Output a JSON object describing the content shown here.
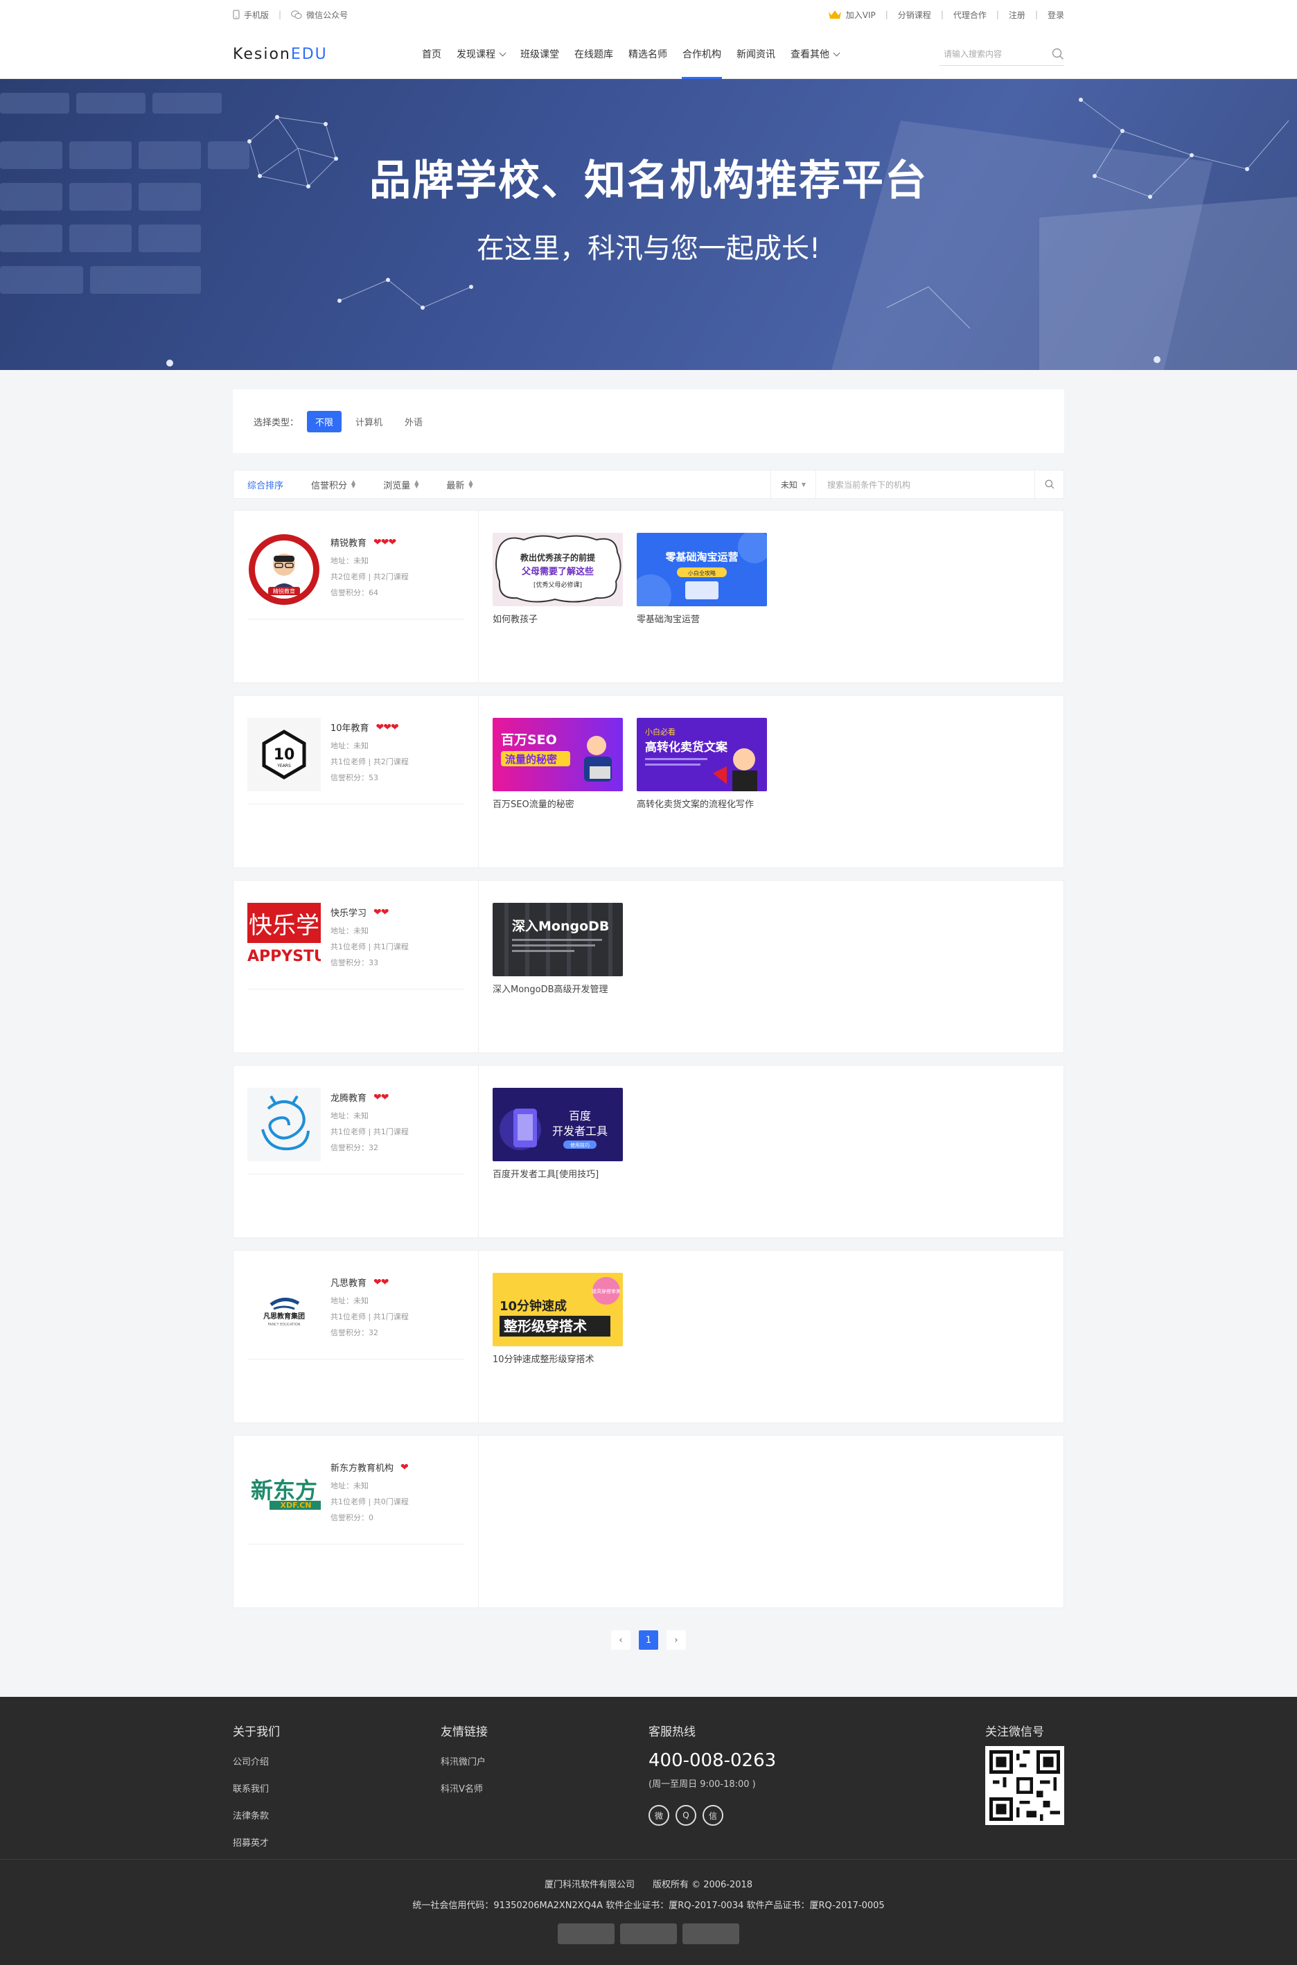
{
  "topbar": {
    "mobile": "手机版",
    "wechat_mp": "微信公众号",
    "vip": "加入VIP",
    "distribute": "分销课程",
    "agent": "代理合作",
    "register": "注册",
    "login": "登录"
  },
  "header": {
    "logo_a": "Kesion",
    "logo_b": "EDU",
    "search_placeholder": "请输入搜索内容",
    "nav": [
      {
        "label": "首页"
      },
      {
        "label": "发现课程"
      },
      {
        "label": "班级课堂"
      },
      {
        "label": "在线题库"
      },
      {
        "label": "精选名师"
      },
      {
        "label": "合作机构"
      },
      {
        "label": "新闻资讯"
      },
      {
        "label": "查看其他"
      }
    ]
  },
  "banner": {
    "title": "品牌学校、知名机构推荐平台",
    "subtitle": "在这里，科汛与您一起成长!"
  },
  "filter": {
    "label": "选择类型：",
    "tags": [
      "不限",
      "计算机",
      "外语"
    ]
  },
  "sort": {
    "items": [
      "综合排序",
      "信誉积分",
      "浏览量",
      "最新"
    ],
    "select": "未知",
    "search_placeholder": "搜索当前条件下的机构"
  },
  "orgs": [
    {
      "name": "精锐教育",
      "hearts": "❤❤❤",
      "addr": "地址：未知",
      "stats": "共2位老师 | 共2门课程",
      "credit": "信誉积分：64",
      "courses": [
        {
          "title": "如何教孩子"
        },
        {
          "title": "零基础淘宝运营"
        }
      ]
    },
    {
      "name": "10年教育",
      "hearts": "❤❤❤",
      "addr": "地址：未知",
      "stats": "共1位老师 | 共2门课程",
      "credit": "信誉积分：53",
      "courses": [
        {
          "title": "百万SEO流量的秘密"
        },
        {
          "title": "高转化卖货文案的流程化写作"
        }
      ]
    },
    {
      "name": "快乐学习",
      "hearts": "❤❤",
      "addr": "地址：未知",
      "stats": "共1位老师 | 共1门课程",
      "credit": "信誉积分：33",
      "courses": [
        {
          "title": "深入MongoDB高级开发管理"
        }
      ]
    },
    {
      "name": "龙腾教育",
      "hearts": "❤❤",
      "addr": "地址：未知",
      "stats": "共1位老师 | 共1门课程",
      "credit": "信誉积分：32",
      "courses": [
        {
          "title": "百度开发者工具[使用技巧]"
        }
      ]
    },
    {
      "name": "凡思教育",
      "hearts": "❤❤",
      "addr": "地址：未知",
      "stats": "共1位老师 | 共1门课程",
      "credit": "信誉积分：32",
      "courses": [
        {
          "title": "10分钟速成整形级穿搭术"
        }
      ]
    },
    {
      "name": "新东方教育机构",
      "hearts": "❤",
      "addr": "地址：未知",
      "stats": "共1位老师 | 共0门课程",
      "credit": "信誉积分：0",
      "courses": []
    }
  ],
  "thumbs": {
    "c1a": {
      "l1": "教出优秀孩子的前提",
      "l2": "父母需要了解这些",
      "l3": "[优秀父母必修课]"
    },
    "c1b": {
      "l1": "零基础淘宝运营",
      "l2": "小白全攻略"
    },
    "c2a": {
      "l1": "百万SEO",
      "l2": "流量的秘密"
    },
    "c2b": {
      "l1": "小白必看",
      "l2": "高转化卖货文案"
    },
    "c3a": {
      "l1": "深入MongoDB"
    },
    "c4a": {
      "l1": "百度",
      "l2": "开发者工具",
      "l3": "使用技巧"
    },
    "c5a": {
      "l1": "10分钟速成",
      "l2": "整形级穿搭术",
      "l3": "提高穿搭审美"
    }
  },
  "logos": {
    "o1": "精锐教育",
    "o2a": "10",
    "o2b": "YEARS",
    "o3a": "快乐学",
    "o3b": "APPYSTUD",
    "o5a": "凡思教育集团",
    "o5b": "FANCY EDUCATION",
    "o6a": "新东方",
    "o6b": "XDF.CN"
  },
  "pager": {
    "prev": "‹",
    "current": "1",
    "next": "›"
  },
  "footer": {
    "about": {
      "title": "关于我们",
      "links": [
        "公司介绍",
        "联系我们",
        "法律条款",
        "招募英才"
      ]
    },
    "friends": {
      "title": "友情链接",
      "links": [
        "科汛微门户",
        "科汛V名师"
      ]
    },
    "service": {
      "title": "客服热线",
      "phone": "400-008-0263",
      "hours": "(周一至周日 9:00-18:00 )"
    },
    "wechat": {
      "title": "关注微信号"
    },
    "copyright": "厦门科汛软件有限公司　　版权所有 © 2006-2018",
    "license": "统一社会信用代码：91350206MA2XN2XQ4A 软件企业证书：厦RQ-2017-0034 软件产品证书：厦RQ-2017-0005"
  },
  "colors": {
    "accent": "#2f6df5",
    "heart": "#e41f2d",
    "footer_bg": "#2b2b2b"
  }
}
